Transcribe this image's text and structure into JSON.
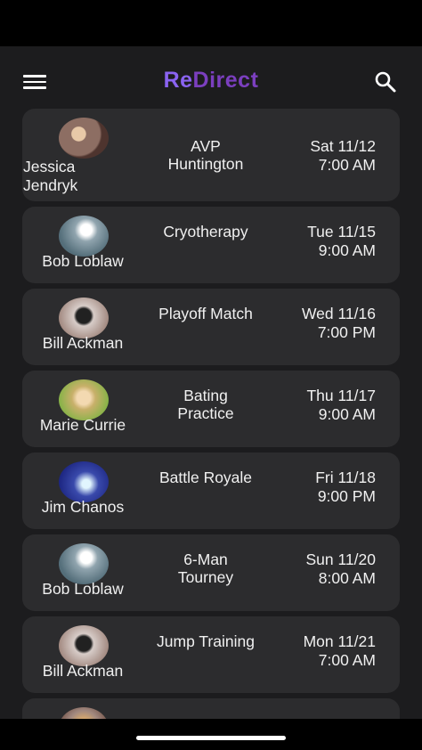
{
  "app": {
    "logo_prefix": "Re",
    "logo_suffix": "Direct",
    "menu_icon": "hamburger-menu-icon",
    "search_icon": "search-icon"
  },
  "sessions": [
    {
      "name_1": "Jessica",
      "name_2": "Jendryk",
      "event_1": "AVP",
      "event_2": "Huntington",
      "date": "Sat  11/12",
      "time": "7:00 AM",
      "avatar_color": "#8d6e63"
    },
    {
      "name_1": "Bob Loblaw",
      "event_1": "Cryotherapy",
      "event_2": "",
      "date": "Tue  11/15",
      "time": "9:00 AM",
      "avatar_color": "#90a4ae"
    },
    {
      "name_1": "Bill Ackman",
      "event_1": "Playoff Match",
      "event_2": "",
      "date": "Wed  11/16",
      "time": "7:00 PM",
      "avatar_color": "#bcaaa4"
    },
    {
      "name_1": "Marie Currie",
      "event_1": "Bating",
      "event_2": "Practice",
      "date": "Thu  11/17",
      "time": "9:00 AM",
      "avatar_color": "#c8b06a"
    },
    {
      "name_1": "Jim Chanos",
      "event_1": "Battle Royale",
      "event_2": "",
      "date": "Fri  11/18",
      "time": "9:00 PM",
      "avatar_color": "#3949ab"
    },
    {
      "name_1": "Bob Loblaw",
      "event_1": "6-Man",
      "event_2": "Tourney",
      "date": "Sun  11/20",
      "time": "8:00 AM",
      "avatar_color": "#90a4ae"
    },
    {
      "name_1": "Bill Ackman",
      "event_1": "Jump Training",
      "event_2": "",
      "date": "Mon  11/21",
      "time": "7:00 AM",
      "avatar_color": "#bcaaa4"
    },
    {
      "name_1": "",
      "event_1": "",
      "event_2": "",
      "date": "",
      "time": "",
      "avatar_color": "#a1887f"
    }
  ]
}
